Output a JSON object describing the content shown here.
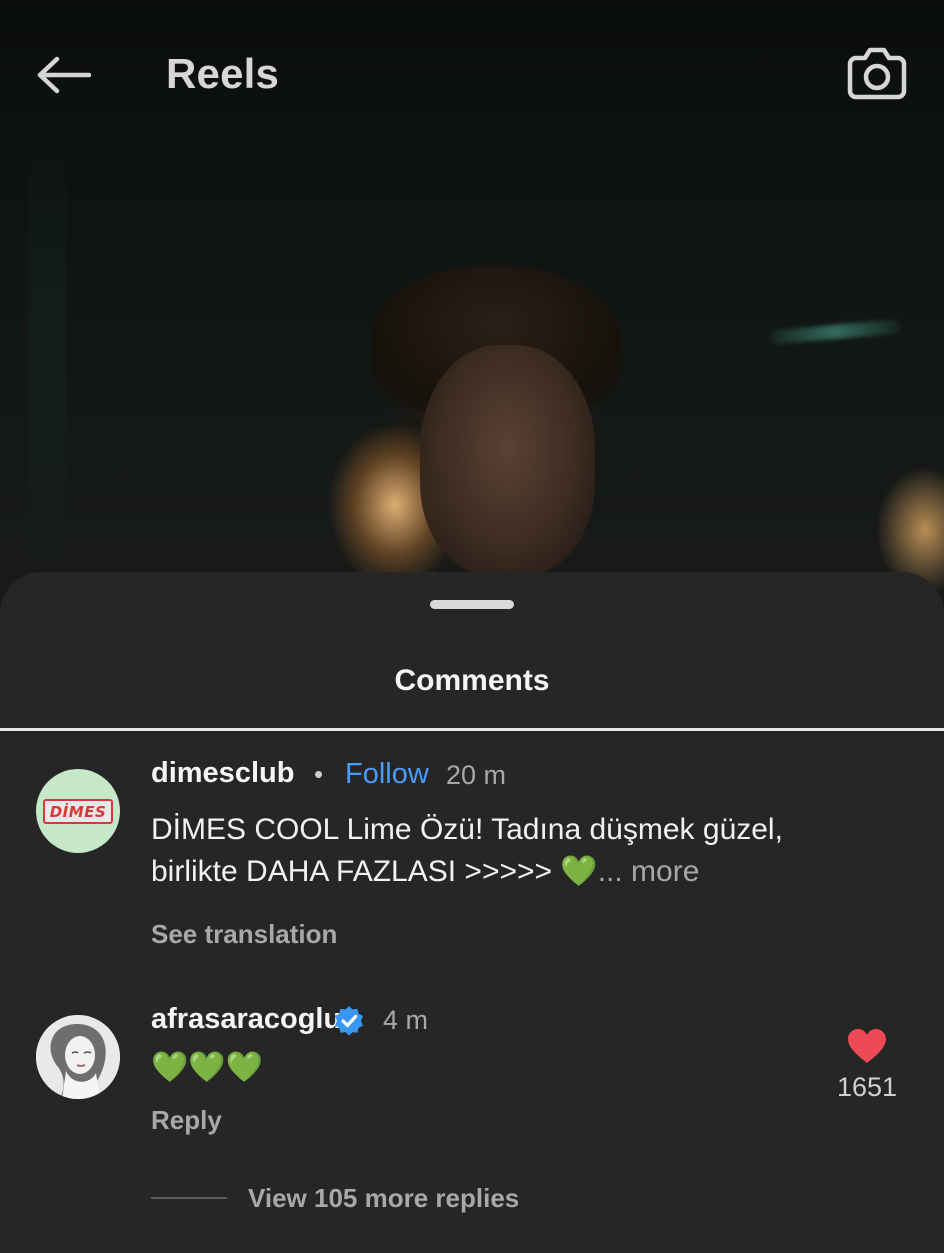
{
  "header": {
    "title": "Reels",
    "back_icon": "arrow-left-icon",
    "camera_icon": "camera-icon"
  },
  "sheet": {
    "title": "Comments"
  },
  "comments": [
    {
      "username": "dimesclub",
      "separator": "•",
      "follow_label": "Follow",
      "time": "20 m",
      "avatar_text": "DİMES",
      "text": "DİMES COOL Lime Özü! Tadına düşmek güzel, birlikte DAHA FAZLASI >>>>> 💚",
      "more_label": "... more",
      "see_translation": "See translation"
    },
    {
      "username": "afrasaracoglu",
      "verified_icon": "verified-badge-icon",
      "time": "4 m",
      "text": "💚💚💚",
      "reply_label": "Reply",
      "like_icon": "heart-filled-icon",
      "likes": "1651",
      "view_replies": "View 105 more replies"
    }
  ],
  "colors": {
    "sheet_bg": "#262626",
    "follow": "#4a9bf5",
    "heart": "#ed4956",
    "verified": "#3897f0",
    "dimes_avatar_bg": "#c7e7c9"
  }
}
